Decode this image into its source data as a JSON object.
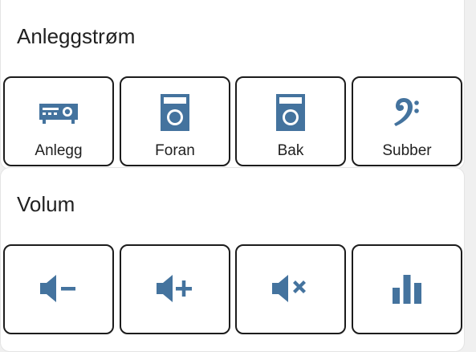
{
  "power_card": {
    "title": "Anleggstrøm",
    "buttons": [
      {
        "label": "Anlegg",
        "icon": "amplifier-icon"
      },
      {
        "label": "Foran",
        "icon": "speaker-icon"
      },
      {
        "label": "Bak",
        "icon": "speaker-icon"
      },
      {
        "label": "Subber",
        "icon": "bass-clef-icon"
      }
    ]
  },
  "volume_card": {
    "title": "Volum",
    "buttons": [
      {
        "icon": "volume-minus-icon"
      },
      {
        "icon": "volume-plus-icon"
      },
      {
        "icon": "volume-mute-icon"
      },
      {
        "icon": "equalizer-icon"
      }
    ]
  },
  "colors": {
    "icon": "#44739e",
    "text": "#212121",
    "button_border": "#1c1c1c",
    "card_background": "#ffffff",
    "page_background": "#f0f0f0"
  }
}
